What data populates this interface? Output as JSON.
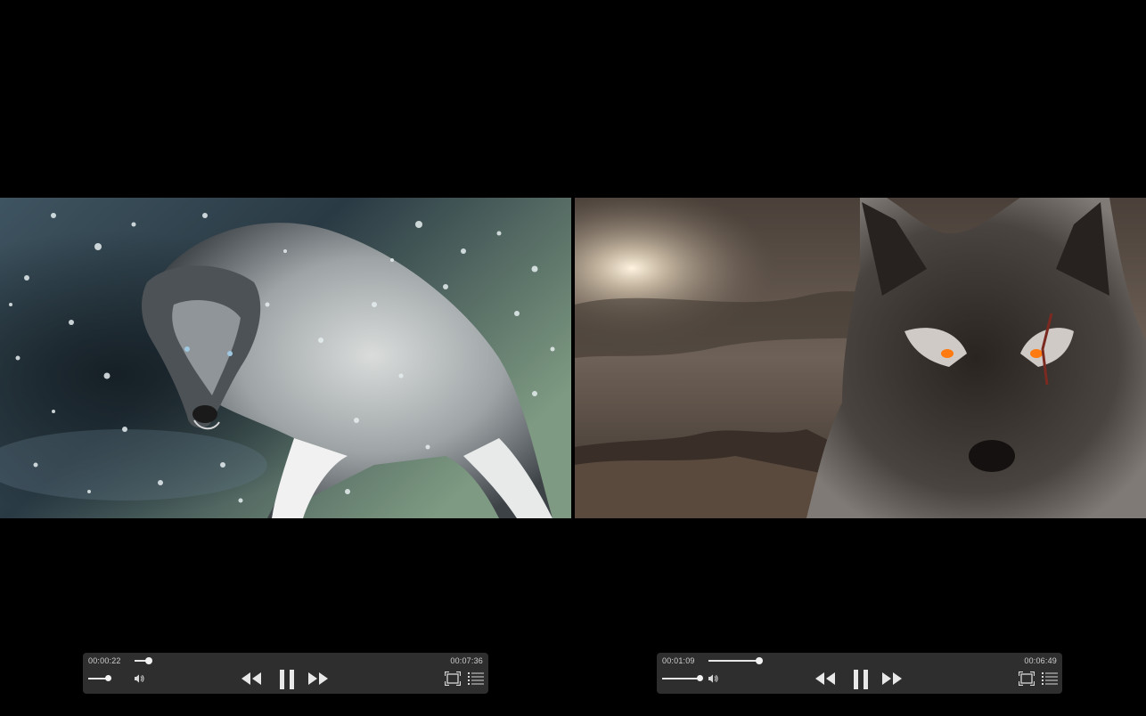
{
  "players": [
    {
      "elapsed": "00:00:22",
      "total": "00:07:36",
      "progress": 0.048,
      "volume": 0.9
    },
    {
      "elapsed": "00:01:09",
      "total": "00:06:49",
      "progress": 0.169,
      "volume": 0.95
    }
  ],
  "icons": {
    "speaker": "speaker-icon",
    "rewind": "rewind-icon",
    "pause": "pause-icon",
    "forward": "fast-forward-icon",
    "fit": "fit-to-screen-icon",
    "playlist": "playlist-icon"
  },
  "colors": {
    "background": "#000000",
    "control_bar": "#303030",
    "text": "#cfcfcf",
    "control_icon": "#e8e8e8"
  }
}
